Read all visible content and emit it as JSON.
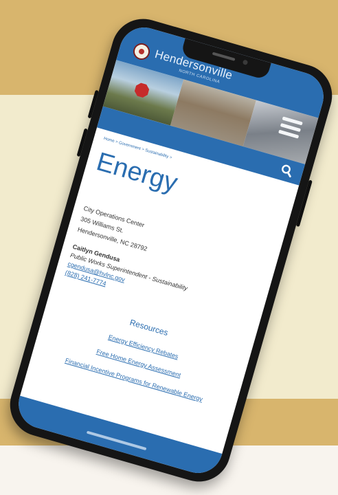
{
  "site": {
    "name": "Hendersonville",
    "subtitle": "NORTH CAROLINA"
  },
  "breadcrumb": "Home > Government > Sustainability >",
  "page": {
    "title": "Energy"
  },
  "address": [
    "City Operations Center",
    "305 Williams St.",
    "Hendersonville, NC 28792"
  ],
  "contact": {
    "name": "Caitlyn Gendusa",
    "role": "Public Works Superintendent - Sustainability",
    "email": "cgendusa@hvlnc.gov",
    "phone": "(828) 241-7774"
  },
  "resources": {
    "heading": "Resources",
    "links": [
      "Energy Efficiency Rebates",
      "Free Home Energy Assessment",
      "Financial Incentive Programs for Renewable Energy"
    ]
  },
  "colors": {
    "brand_blue": "#2a6db0",
    "background_tan": "#d8b56d",
    "background_cream": "#f2ebcd"
  },
  "icons": {
    "menu": "hamburger-menu-icon",
    "search": "search-icon",
    "seal": "city-seal-logo"
  }
}
